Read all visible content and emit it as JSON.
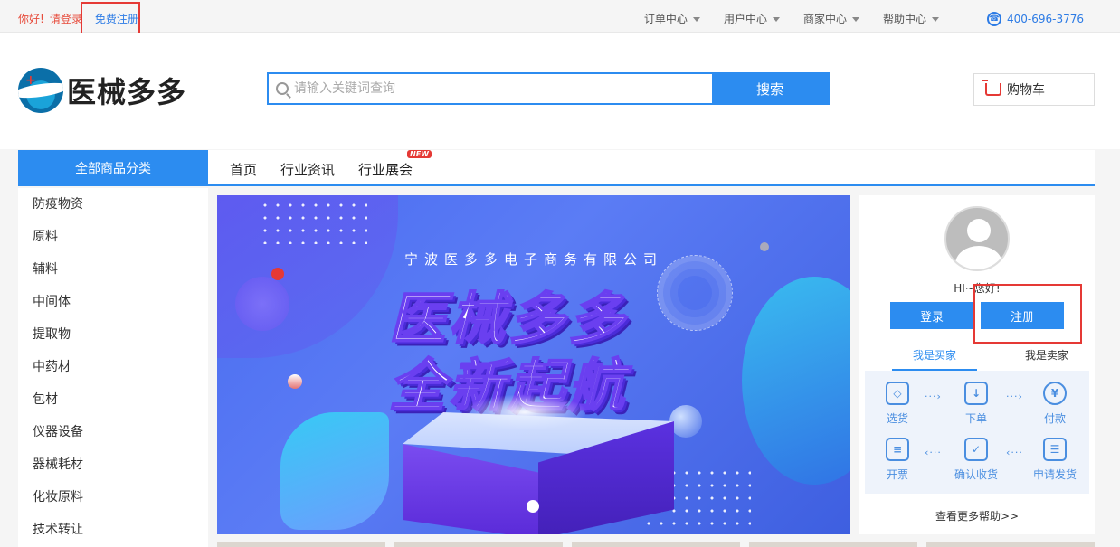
{
  "topbar": {
    "greeting": "你好!",
    "login": "请登录",
    "register": "免费注册",
    "menus": [
      "订单中心",
      "用户中心",
      "商家中心",
      "帮助中心"
    ],
    "phone": "400-696-3776"
  },
  "header": {
    "logo_text": "医械多多",
    "search_placeholder": "请输入关键词查询",
    "search_button": "搜索",
    "cart_label": "购物车"
  },
  "nav": {
    "all_categories": "全部商品分类",
    "links": [
      "首页",
      "行业资讯",
      "行业展会"
    ],
    "new_badge": "NEW"
  },
  "sidebar": {
    "items": [
      "防疫物资",
      "原料",
      "辅料",
      "中间体",
      "提取物",
      "中药材",
      "包材",
      "仪器设备",
      "器械耗材",
      "化妆原料",
      "技术转让"
    ]
  },
  "banner": {
    "company": "宁波医多多电子商务有限公司",
    "slogan_line1": "医械多多",
    "slogan_line2": "全新起航"
  },
  "user_panel": {
    "hi": "HI~您好!",
    "login_button": "登录",
    "register_button": "注册",
    "roles": [
      "我是买家",
      "我是卖家"
    ],
    "steps": [
      "选货",
      "下单",
      "付款",
      "开票",
      "确认收货",
      "申请发货"
    ],
    "more_help": "查看更多帮助>>"
  },
  "colors": {
    "accent": "#2c8cf0",
    "highlight_box": "#e53935"
  }
}
